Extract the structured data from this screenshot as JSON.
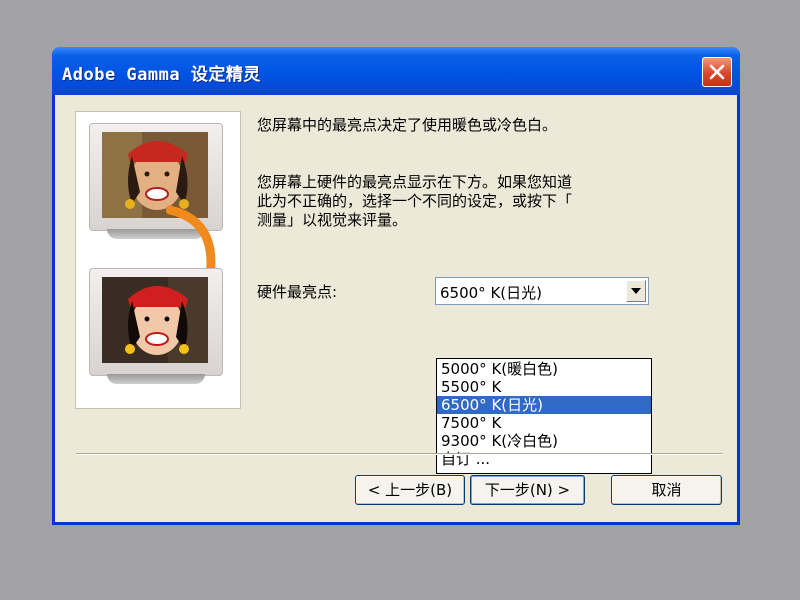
{
  "window": {
    "title": "Adobe Gamma 设定精灵"
  },
  "content": {
    "paragraph1": "您屏幕中的最亮点决定了使用暖色或冷色白。",
    "paragraph2": "您屏幕上硬件的最亮点显示在下方。如果您知道\n此为不正确的，选择一个不同的设定，或按下「\n测量」以视觉来评量。"
  },
  "white_point": {
    "label": "硬件最亮点:",
    "value": "6500° K(日光)",
    "options": [
      "5000° K(暖白色)",
      "5500° K",
      "6500° K(日光)",
      "7500° K",
      "9300° K(冷白色)",
      "自订 ..."
    ],
    "selected_index": 2
  },
  "buttons": {
    "back": "< 上一步(B)",
    "next": "下一步(N) >",
    "cancel": "取消"
  },
  "colors": {
    "titlebar": "#0054e3",
    "selection": "#316ac5",
    "dialog_bg": "#ece9d8",
    "close": "#d9472a",
    "arrow": "#f08a1c"
  }
}
